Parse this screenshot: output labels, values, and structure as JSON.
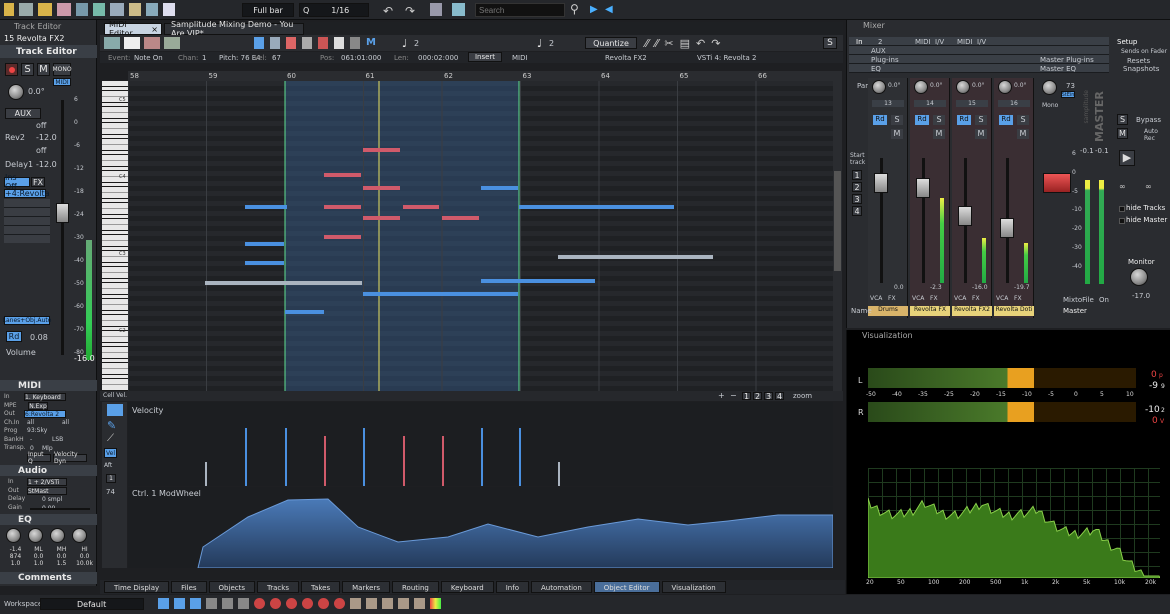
{
  "toolbar": {
    "grid_mode": "Full bar",
    "quantize": "1/16",
    "search_placeholder": "Search",
    "quantize_label": "Q"
  },
  "track_editor": {
    "title": "Track Editor",
    "track": "15  Revolta FX2",
    "section": "Track Editor",
    "midi_badge": "MIDI",
    "aux": "AUX",
    "rev": "Rev2",
    "rev_val": "-12.0",
    "delay": "Delay1",
    "delay_val": "-12.0",
    "off1": "off",
    "off2": "off",
    "pan": "0.0°",
    "ins": "Ins Off",
    "fx": "FX",
    "route": "+4:Revolta",
    "lanes": "Lanes+Obj.Auto",
    "rd": "Rd",
    "rd_val": "0.08",
    "volume": "Volume",
    "vol_val": "-16.0",
    "scale": [
      "6",
      "0",
      "-6",
      "-12",
      "-18",
      "-24",
      "-30",
      "-40",
      "-50",
      "-60",
      "-70",
      "-80"
    ]
  },
  "midi_section": {
    "title": "MIDI",
    "in": "1. Keyboard",
    "mpe": "N.Exp",
    "out": "6:Revolta 2",
    "ch_in": "all",
    "ch_out": "all",
    "prog": "93:Sky",
    "bank": "-",
    "lsb": "LSB",
    "transp": "0",
    "mlp": "Mlp",
    "input_q": "Input Q",
    "vel_dyn": "Velocity Dyn",
    "labels": [
      "In",
      "MPE",
      "Out",
      "Ch.In",
      "Prog",
      "BankH",
      "Transp."
    ]
  },
  "audio_section": {
    "title": "Audio",
    "in": "1 + 2/VSTi",
    "out": "StMast",
    "delay": "0 smpl",
    "gain": "0.00",
    "labels": [
      "In",
      "Out",
      "Delay",
      "Gain"
    ]
  },
  "eq_section": {
    "title": "EQ",
    "bands": [
      {
        "name": "LO",
        "gain": "-1.4",
        "freq": "874",
        "q": "1.0"
      },
      {
        "name": "ML",
        "gain": "0.0",
        "freq": "1.0",
        "q": "1.0"
      },
      {
        "name": "MH",
        "gain": "0.0",
        "freq": "1.5",
        "q": "1.0"
      },
      {
        "name": "HI",
        "gain": "0.0",
        "freq": "10.0k",
        "q": "1.0"
      }
    ]
  },
  "comments": "Comments",
  "workspace": {
    "label": "Workspace:",
    "value": "Default"
  },
  "editor": {
    "tabs": [
      "MIDI Editor",
      "Samplitude Mixing Demo - You Are.VIP*"
    ],
    "info": {
      "event": "Event:",
      "event_val": "Note On",
      "chan": "Chan:",
      "chan_val": "1",
      "pitch": "Pitch: 76 E4",
      "vel": "Vel:",
      "vel_val": "67",
      "pos": "Pos:",
      "pos_val": "061:01:000",
      "len": "Len:",
      "len_val": "000:02:000",
      "insert": "Insert",
      "midi": "MIDI",
      "instrument": "Revolta FX2",
      "vsti": "VSTi 4: Revolta 2"
    },
    "quantize_btn": "Quantize",
    "snap_val": "2",
    "snap_val2": "2",
    "s": "S",
    "bars": [
      "58",
      "59",
      "60",
      "61",
      "62",
      "63",
      "64",
      "65",
      "66"
    ],
    "octaves": [
      "C5",
      "C4",
      "C3",
      "C2"
    ],
    "cell_vel": "Cell Vel.",
    "zoom": "zoom",
    "zoom_btns": [
      "1",
      "2",
      "3",
      "4"
    ],
    "velocity_label": "Velocity",
    "ctrl_label": "Ctrl. 1 ModWheel",
    "vel_btn": "Vel",
    "aft": "Aft",
    "ctrl_num": "74"
  },
  "bottom_tabs": [
    "Time Display",
    "Files",
    "Objects",
    "Tracks",
    "Takes",
    "Markers",
    "Routing",
    "Keyboard",
    "Info",
    "Automation",
    "Object Editor",
    "Visualization"
  ],
  "mixer": {
    "title": "Mixer",
    "in": "In",
    "num": "2",
    "midi1": "MIDI",
    "iv1": "I/V",
    "midi2": "MIDI",
    "iv2": "I/V",
    "aux": "AUX",
    "plugins": "Plug-ins",
    "eq": "EQ",
    "master_plugins": "Master Plug-ins",
    "master_eq": "Master EQ",
    "setup": "Setup",
    "sends_on_fader": "Sends on Fader",
    "resets": "Resets",
    "snapshots": "Snapshots",
    "pan": "Pan",
    "master_label": "MASTER",
    "brand": "samplitude",
    "channels": [
      {
        "num": "13",
        "pan": "0.0°",
        "db": "0.0",
        "name": "Drums"
      },
      {
        "num": "14",
        "pan": "0.0°",
        "db": "-2.3",
        "name": "Revolta FX"
      },
      {
        "num": "15",
        "pan": "0.0°",
        "db": "-16.0",
        "name": "Revolta FX2"
      },
      {
        "num": "16",
        "pan": "0.0°",
        "db": "-19.7",
        "name": "Revolta Doti"
      }
    ],
    "master": {
      "peak_l": "-0.1",
      "peak_r": "-0.1",
      "mixtofile": "MixtoFile",
      "on": "On",
      "name": "Master",
      "pan_val": "73",
      "stein": "StEin",
      "mono": "Mono"
    },
    "rd": "Rd",
    "s": "S",
    "m": "M",
    "vca": "VCA",
    "fx": "FX",
    "name_label": "Name",
    "start_track": "Start track",
    "track_nums": [
      "1",
      "2",
      "3",
      "4"
    ],
    "bypass": "Bypass",
    "auto_rec": "Auto Rec",
    "hide_tracks": "hide Tracks",
    "hide_master": "hide Master",
    "monitor": "Monitor",
    "monitor_val": "-17.0",
    "fader_scale": [
      "6",
      "0",
      "-5",
      "-10",
      "-20",
      "-30",
      "-40"
    ]
  },
  "visualization": {
    "title": "Visualization",
    "L": "L",
    "R": "R",
    "peak_L": "0",
    "rms_L": "-9",
    "peak_R": "-10",
    "rms_R": "0",
    "L_unit_p": "p",
    "L_unit_r": "9",
    "R_unit_p": "2",
    "R_unit_r": "V",
    "meter_ticks": [
      "-50",
      "-40",
      "-35",
      "-25",
      "-20",
      "-15",
      "-10",
      "-5",
      "0",
      "5",
      "10"
    ],
    "freq_ticks": [
      "20",
      "50",
      "100",
      "200",
      "500",
      "1k",
      "2k",
      "5k",
      "10k",
      "20k"
    ]
  },
  "colors": {
    "accent": "#5aa0e8",
    "red_note": "#d05a6a",
    "blue_note": "#4a90e0",
    "grey_note": "#aab4c0",
    "selection": "#2b3f5c",
    "playhead": "#e8e060",
    "loop": "#60e090"
  }
}
